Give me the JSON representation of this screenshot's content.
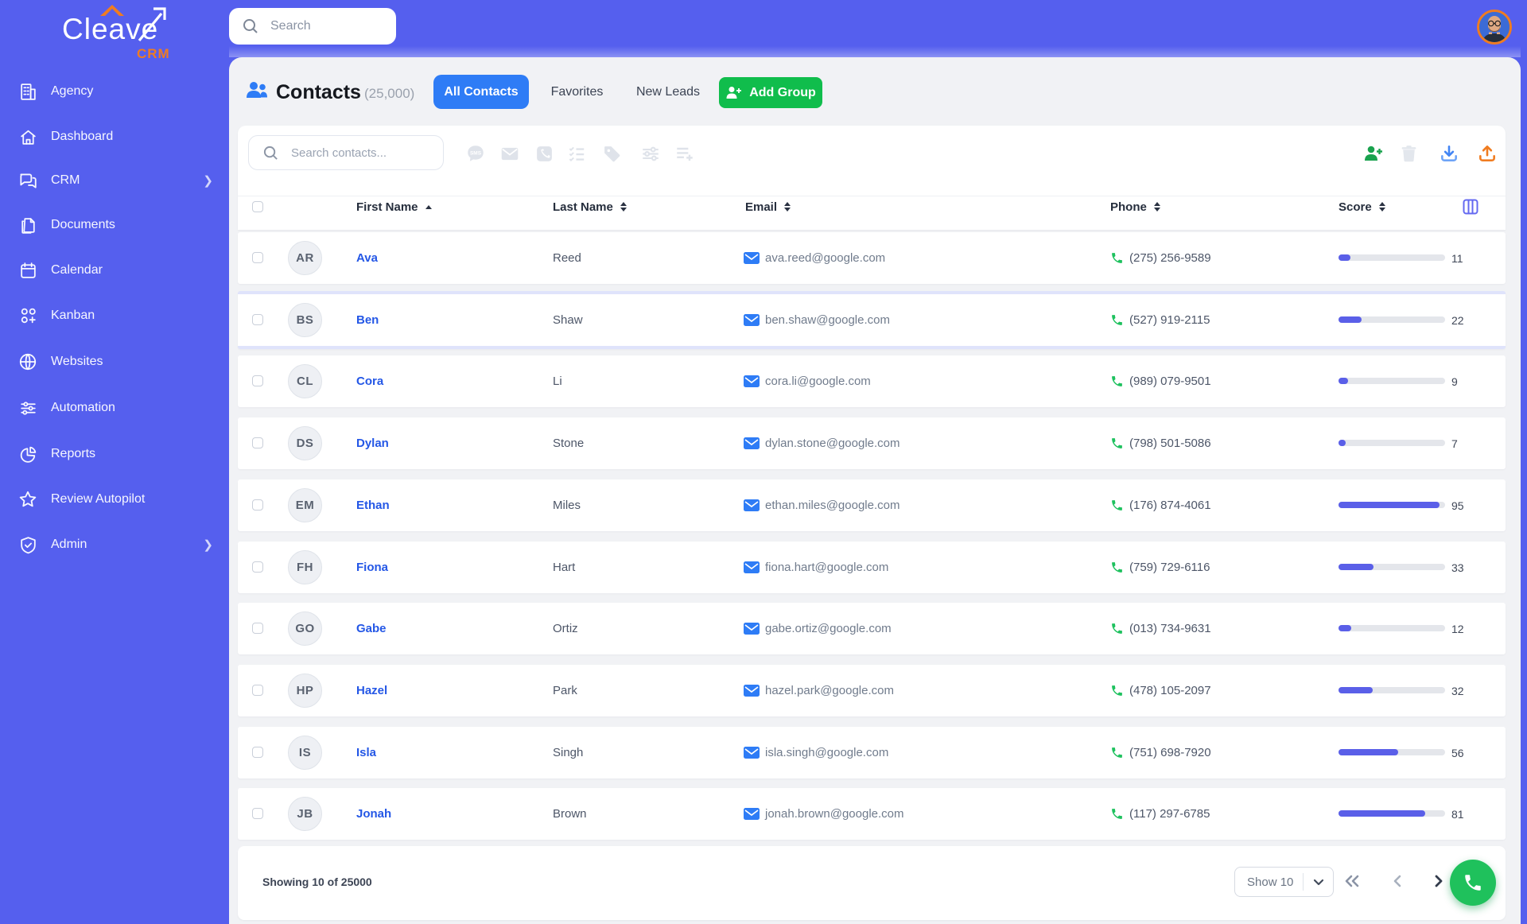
{
  "brand": {
    "name": "Cleave",
    "sub": "CRM"
  },
  "topbar": {
    "search_placeholder": "Search"
  },
  "sidebar": {
    "items": [
      {
        "label": "Agency",
        "icon": "building",
        "chevron": false
      },
      {
        "label": "Dashboard",
        "icon": "home",
        "chevron": false
      },
      {
        "label": "CRM",
        "icon": "chat",
        "chevron": true
      },
      {
        "label": "Documents",
        "icon": "documents",
        "chevron": false
      },
      {
        "label": "Calendar",
        "icon": "calendar",
        "chevron": false
      },
      {
        "label": "Kanban",
        "icon": "kanban",
        "chevron": false
      },
      {
        "label": "Websites",
        "icon": "globe",
        "chevron": false
      },
      {
        "label": "Automation",
        "icon": "sliders",
        "chevron": false
      },
      {
        "label": "Reports",
        "icon": "pie",
        "chevron": false
      },
      {
        "label": "Review Autopilot",
        "icon": "star",
        "chevron": false
      },
      {
        "label": "Admin",
        "icon": "shield",
        "chevron": true
      }
    ]
  },
  "header": {
    "title": "Contacts",
    "count": "(25,000)",
    "tabs": {
      "all": "All Contacts",
      "favorites": "Favorites",
      "new_leads": "New Leads"
    },
    "add_group_label": "Add Group"
  },
  "toolbar": {
    "search_placeholder": "Search contacts..."
  },
  "table": {
    "columns": {
      "first": "First Name",
      "last": "Last Name",
      "email": "Email",
      "phone": "Phone",
      "score": "Score"
    },
    "rows": [
      {
        "initials": "AR",
        "first": "Ava",
        "last": "Reed",
        "email": "ava.reed@google.com",
        "phone": "(275) 256-9589",
        "score": 11,
        "highlighted": false
      },
      {
        "initials": "BS",
        "first": "Ben",
        "last": "Shaw",
        "email": "ben.shaw@google.com",
        "phone": "(527) 919-2115",
        "score": 22,
        "highlighted": true
      },
      {
        "initials": "CL",
        "first": "Cora",
        "last": "Li",
        "email": "cora.li@google.com",
        "phone": "(989) 079-9501",
        "score": 9,
        "highlighted": false
      },
      {
        "initials": "DS",
        "first": "Dylan",
        "last": "Stone",
        "email": "dylan.stone@google.com",
        "phone": "(798) 501-5086",
        "score": 7,
        "highlighted": false
      },
      {
        "initials": "EM",
        "first": "Ethan",
        "last": "Miles",
        "email": "ethan.miles@google.com",
        "phone": "(176) 874-4061",
        "score": 95,
        "highlighted": false
      },
      {
        "initials": "FH",
        "first": "Fiona",
        "last": "Hart",
        "email": "fiona.hart@google.com",
        "phone": "(759) 729-6116",
        "score": 33,
        "highlighted": false
      },
      {
        "initials": "GO",
        "first": "Gabe",
        "last": "Ortiz",
        "email": "gabe.ortiz@google.com",
        "phone": "(013) 734-9631",
        "score": 12,
        "highlighted": false
      },
      {
        "initials": "HP",
        "first": "Hazel",
        "last": "Park",
        "email": "hazel.park@google.com",
        "phone": "(478) 105-2097",
        "score": 32,
        "highlighted": false
      },
      {
        "initials": "IS",
        "first": "Isla",
        "last": "Singh",
        "email": "isla.singh@google.com",
        "phone": "(751) 698-7920",
        "score": 56,
        "highlighted": false
      },
      {
        "initials": "JB",
        "first": "Jonah",
        "last": "Brown",
        "email": "jonah.brown@google.com",
        "phone": "(117) 297-6785",
        "score": 81,
        "highlighted": false
      }
    ]
  },
  "footer": {
    "showing": "Showing 10 of 25000",
    "page_size_label": "Show 10"
  }
}
